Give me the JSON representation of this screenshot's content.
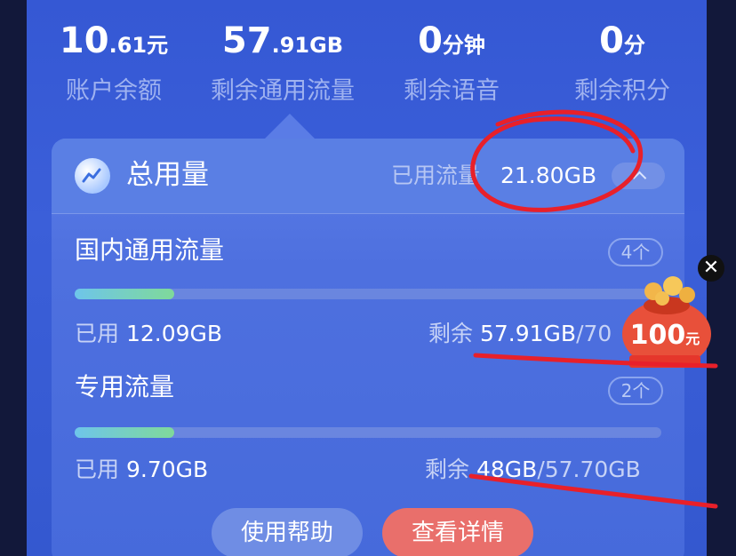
{
  "stats": [
    {
      "value_main": "10",
      "value_dec": ".61",
      "unit": "元",
      "label": "账户余额"
    },
    {
      "value_main": "57",
      "value_dec": ".91",
      "unit": "GB",
      "label": "剩余通用流量"
    },
    {
      "value_main": "0",
      "value_dec": "",
      "unit": "分钟",
      "label": "剩余语音"
    },
    {
      "value_main": "0",
      "value_dec": "",
      "unit": "分",
      "label": "剩余积分"
    }
  ],
  "total": {
    "title": "总用量",
    "used_label": "已用流量",
    "used_value": "21.80GB"
  },
  "domestic": {
    "title": "国内通用流量",
    "count": "4个",
    "used_label": "已用",
    "used_value": "12.09GB",
    "remain_label": "剩余",
    "remain_value": "57.91GB",
    "total_suffix": "/70",
    "progress": 0.17
  },
  "dedicated": {
    "title": "专用流量",
    "count": "2个",
    "used_label": "已用",
    "used_value": "9.70GB",
    "remain_label": "剩余",
    "remain_value": "48GB",
    "total_suffix": "/57.70GB",
    "progress": 0.17
  },
  "buttons": {
    "help": "使用帮助",
    "detail": "查看详情"
  },
  "promo": {
    "amount": "100",
    "unit": "元",
    "close": "✕"
  },
  "colors": {
    "accent_red": "#e96f6b",
    "annotation_red": "#e8202a",
    "progress_start": "#6ec5ea",
    "progress_end": "#7fd99a"
  }
}
